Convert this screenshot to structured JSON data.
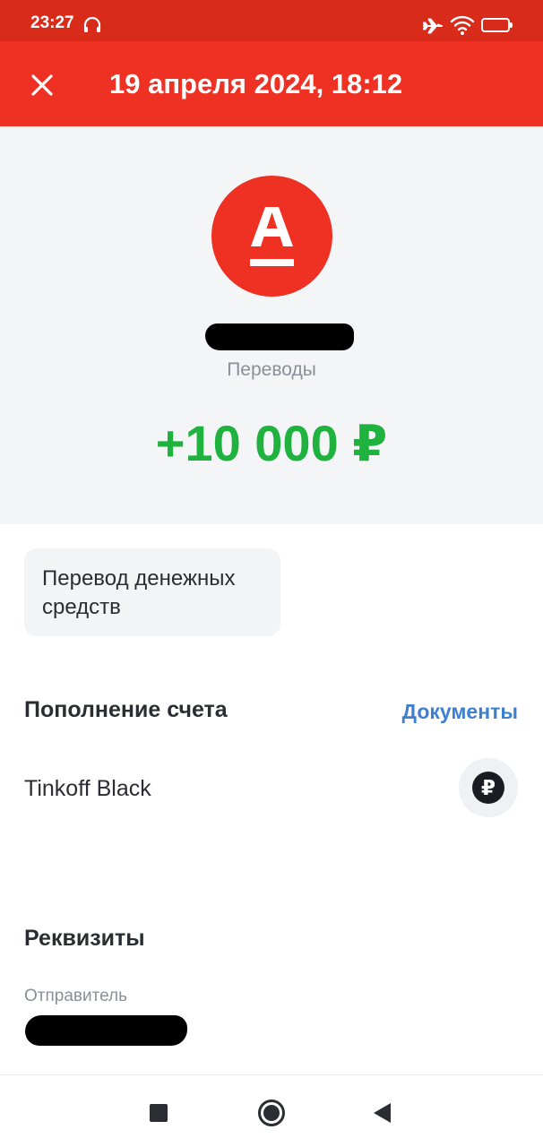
{
  "status_bar": {
    "time": "23:27",
    "battery": "66",
    "battery_level": 0.66,
    "icons": [
      "headphones-icon",
      "airplane-mode-icon",
      "wifi-icon",
      "battery-icon"
    ]
  },
  "header": {
    "title": "19 апреля 2024, 18:12",
    "close_icon": "close-icon"
  },
  "transaction": {
    "merchant_logo": "alfa-bank-logo",
    "category": "Переводы",
    "amount": "+10 000 ₽"
  },
  "chip": {
    "label": "Перевод денежных средств"
  },
  "account_section": {
    "title": "Пополнение счета",
    "documents_link": "Документы",
    "account_name": "Tinkoff Black",
    "account_icon": "ruble-icon",
    "account_icon_symbol": "₽"
  },
  "details_section": {
    "title": "Реквизиты",
    "sender_label": "Отправитель"
  },
  "nav": {
    "icons": [
      "recent-apps-icon",
      "home-icon",
      "back-icon"
    ]
  },
  "colors": {
    "header_red": "#ef3124",
    "status_red": "#d92b1a",
    "amount_green": "#1fb23f",
    "link_blue": "#3d80d0"
  }
}
